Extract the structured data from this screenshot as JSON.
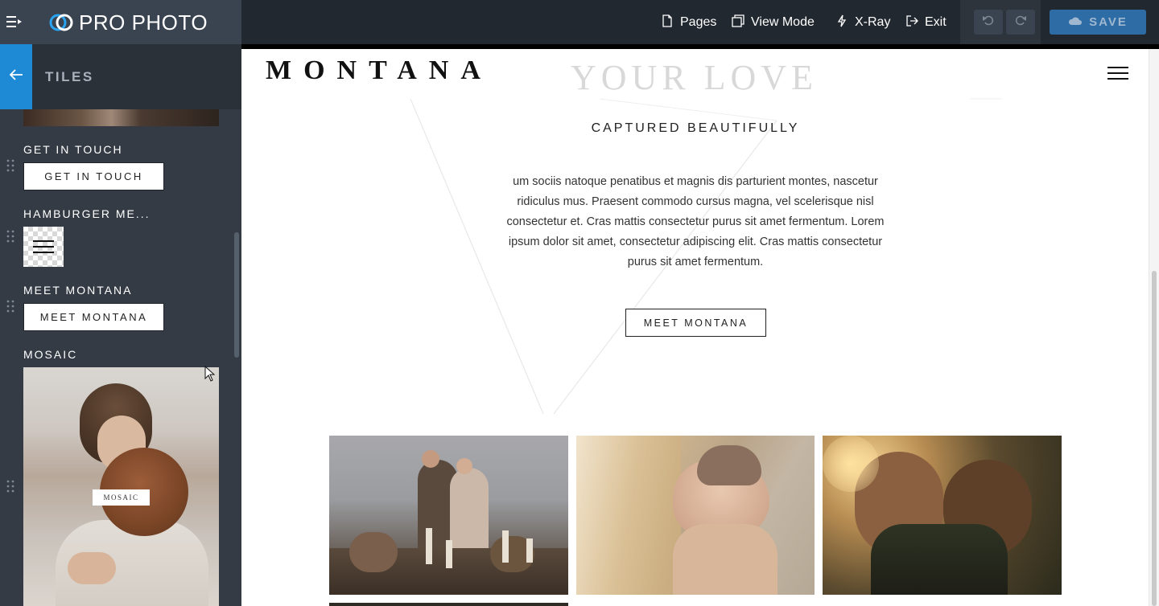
{
  "topbar": {
    "brand_name": "PRO PHOTO",
    "pages_label": "Pages",
    "view_mode_label": "View Mode",
    "xray_label": "X-Ray",
    "exit_label": "Exit",
    "save_label": "SAVE"
  },
  "sidebar": {
    "title": "TILES",
    "tiles": [
      {
        "label": "GET IN TOUCH",
        "preview_text": "GET IN TOUCH"
      },
      {
        "label": "HAMBURGER ME...",
        "preview_text": ""
      },
      {
        "label": "MEET MONTANA",
        "preview_text": "MEET MONTANA"
      },
      {
        "label": "MOSAIC",
        "preview_text": "MOSAIC"
      }
    ]
  },
  "site": {
    "logo": "MONTANA",
    "hero_title": "YOUR LOVE",
    "hero_subtitle": "CAPTURED BEAUTIFULLY",
    "hero_body": "um sociis natoque penatibus et magnis dis parturient montes, nascetur ridiculus mus. Praesent commodo cursus magna, vel scelerisque nisl consectetur et. Cras mattis consectetur purus sit amet fermentum. Lorem ipsum dolor sit amet, consectetur adipiscing elit. Cras mattis consectetur purus sit amet fermentum.",
    "hero_button": "MEET MONTANA"
  },
  "colors": {
    "topbar_bg": "#22282f",
    "sidebar_bg": "#343b45",
    "accent_blue": "#1e8ad6",
    "save_bg": "#2e6ca6"
  },
  "icons": {
    "menu_toggle": "sidebar-toggle-icon",
    "pages": "page-icon",
    "view_mode": "window-icon",
    "xray": "lightning-icon",
    "exit": "exit-icon",
    "undo": "undo-icon",
    "redo": "redo-icon",
    "save": "cloud-icon",
    "back": "arrow-left-icon",
    "drag": "drag-handle-icon"
  }
}
